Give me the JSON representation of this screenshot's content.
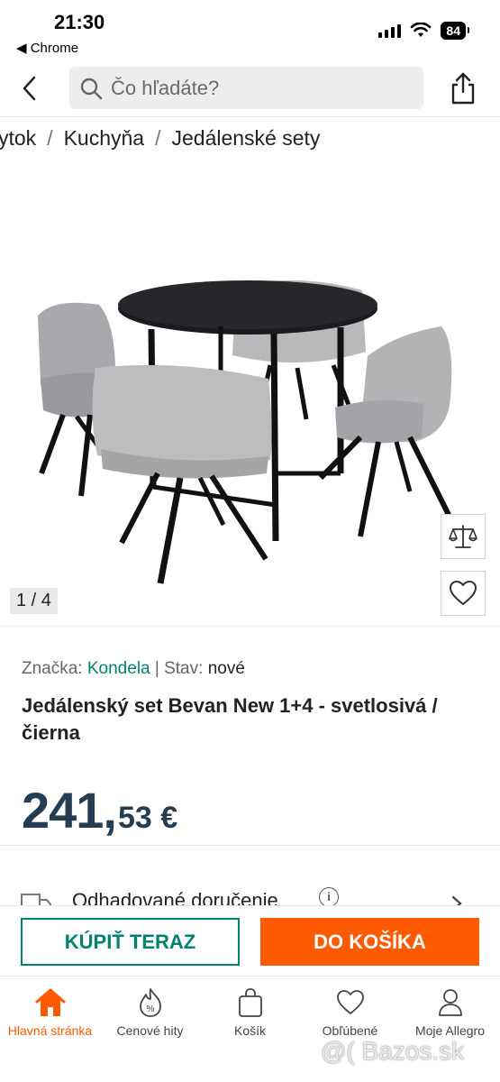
{
  "status_bar": {
    "time": "21:30",
    "back_app": "◀ Chrome",
    "battery": "84"
  },
  "header": {
    "search_placeholder": "Čo hľadáte?"
  },
  "breadcrumb": [
    "ytok",
    "Kuchyňa",
    "Jedálenské sety"
  ],
  "gallery": {
    "counter": "1 / 4"
  },
  "product": {
    "brand_label": "Značka:",
    "brand": "Kondela",
    "condition_label": "Stav:",
    "condition": "nové",
    "title": "Jedálenský set Bevan New 1+4 - svetlosivá / čierna",
    "price_major": "241,",
    "price_minor": "53 €"
  },
  "delivery": {
    "label": "Odhadované doručenie"
  },
  "actions": {
    "buy_now": "KÚPIŤ TERAZ",
    "add_to_cart": "DO KOŠÍKA"
  },
  "bottom_nav": [
    {
      "label": "Hlavná stránka",
      "icon": "home-icon",
      "active": true
    },
    {
      "label": "Cenové hity",
      "icon": "price-hits-icon",
      "active": false
    },
    {
      "label": "Košík",
      "icon": "cart-bag-icon",
      "active": false
    },
    {
      "label": "Obľúbené",
      "icon": "heart-icon",
      "active": false
    },
    {
      "label": "Moje Allegro",
      "icon": "user-icon",
      "active": false
    }
  ],
  "watermark": "@( Bazos.sk",
  "colors": {
    "accent_orange": "#ff5a00",
    "accent_green": "#00836d",
    "price": "#243d52"
  }
}
